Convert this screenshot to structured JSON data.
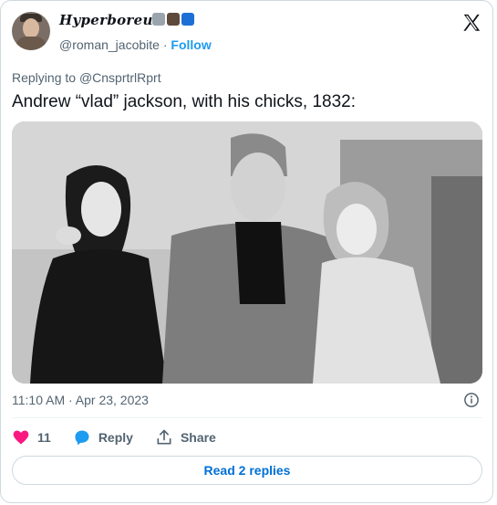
{
  "author": {
    "display_name": "Hyperboreus",
    "handle": "@roman_jacobite",
    "separator": " · ",
    "follow_label": "Follow",
    "badges": [
      "wolf-emoji",
      "eagle-emoji",
      "flag-emoji"
    ]
  },
  "reply_context": {
    "prefix": "Replying to ",
    "target": "@CnsprtrlRprt"
  },
  "tweet": {
    "text": "Andrew “vlad” jackson, with his chicks, 1832:",
    "timestamp": "11:10 AM · Apr 23, 2023"
  },
  "actions": {
    "like_count": "11",
    "reply_label": "Reply",
    "share_label": "Share"
  },
  "read_replies_label": "Read 2 replies",
  "colors": {
    "accent": "#1d9bf0",
    "like": "#f91880",
    "link_button": "#006fd6",
    "muted": "#536471"
  },
  "icons": [
    "x-logo-icon",
    "info-icon",
    "heart-icon",
    "reply-bubble-icon",
    "share-icon"
  ]
}
